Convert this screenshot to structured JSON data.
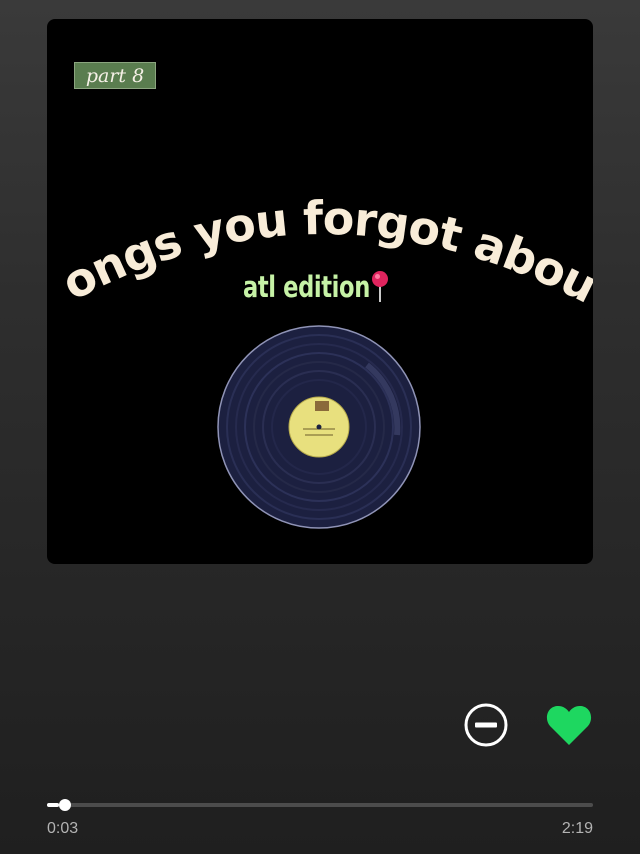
{
  "artwork": {
    "badge": "part 8",
    "title": "songs you forgot about",
    "subtitle": "atl edition",
    "subtitle_emoji": "round-pushpin-icon"
  },
  "controls": {
    "remove_icon": "minus-circle-icon",
    "like_icon": "heart-filled-icon",
    "like_color": "#1ed760"
  },
  "playback": {
    "elapsed": "0:03",
    "duration": "2:19",
    "progress_fraction": 0.022
  },
  "colors": {
    "badge_bg": "#5a7d4f",
    "title_color": "#f8ecd8",
    "subtitle_color": "#c6f2a6",
    "background": "#2b2b2b"
  }
}
